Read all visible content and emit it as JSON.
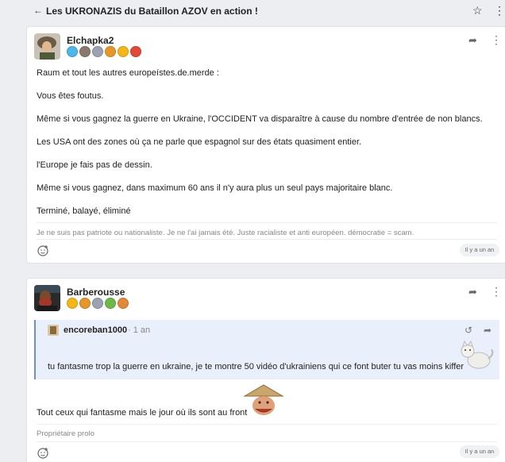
{
  "header": {
    "back_icon": "arrow-left-icon",
    "title": "Les UKRONAZIS du Bataillon AZOV en action !",
    "star_icon": "star-icon",
    "more_icon": "kebab-icon"
  },
  "posts": [
    {
      "username": "Elchapka2",
      "badge_colors": [
        "#4fb6e8",
        "#8a7a6e",
        "#9ba2b0",
        "#e7962a",
        "#f4b61a",
        "#e04a3a"
      ],
      "paragraphs": [
        "Raum et tout les autres europeístes.de.merde :",
        "Vous êtes foutus.",
        "Même si vous gagnez la guerre en Ukraine, l'OCCIDENT va disparaître à cause du nombre d'entrée de non blancs.",
        "Les USA ont des zones où ça ne parle que espagnol sur des états quasiment entier.",
        "l'Europe je fais pas de dessin.",
        "Même si vous gagnez, dans maximum 60 ans il n'y aura plus un seul pays majoritaire blanc.",
        "Terminé, balayé, éliminé"
      ],
      "signature": "Je ne suis pas patriote ou nationaliste. Je ne l'ai jamais été. Juste racialiste et anti européen. démocratie = scam.",
      "date": "Il y a un an"
    },
    {
      "username": "Barberousse",
      "badge_colors": [
        "#f4b61a",
        "#e7962a",
        "#9ba2b0",
        "#6eb84a",
        "#e08a3a"
      ],
      "quote": {
        "username": "encoreban1000",
        "separator": "·",
        "time": "1 an",
        "text": "tu fantasme trop la guerre en ukraine, je te montre 50 vidéo d'ukrainiens qui ce font buter tu vas moins kiffer"
      },
      "body": "Tout ceux qui fantasme mais le jour où ils sont au front",
      "signature": "Propriétaire prolo",
      "date": "Il y a un an"
    }
  ]
}
